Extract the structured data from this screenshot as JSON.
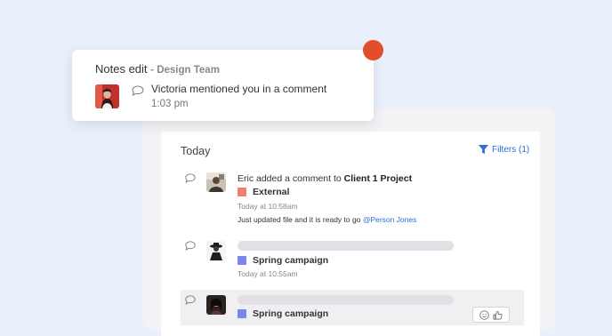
{
  "notification": {
    "title": "Notes edit",
    "team": "- Design Team",
    "message": "Victoria mentioned you in a comment",
    "time": "1:03 pm",
    "dot_color": "#e24e2a"
  },
  "feed": {
    "heading": "Today",
    "filters_label": "Filters (1)",
    "items": [
      {
        "text_prefix": "Eric added a comment to ",
        "text_bold": "Client 1 Project",
        "tag": "External",
        "tag_color": "#f08070",
        "time": "Today at 10:58am",
        "detail_text": "Just updated file and it is ready to go ",
        "detail_mention": "@Person Jones",
        "icon": "comment-bubble-icon"
      },
      {
        "tag": "Spring campaign",
        "tag_color": "#7b84f0",
        "time": "Today at 10:55am",
        "icon": "comment-bubble-icon"
      },
      {
        "tag": "Spring campaign",
        "tag_color": "#7b84f0",
        "icon": "comment-bubble-icon",
        "reactions": [
          "smiley-icon",
          "thumbs-up-icon"
        ]
      }
    ]
  }
}
